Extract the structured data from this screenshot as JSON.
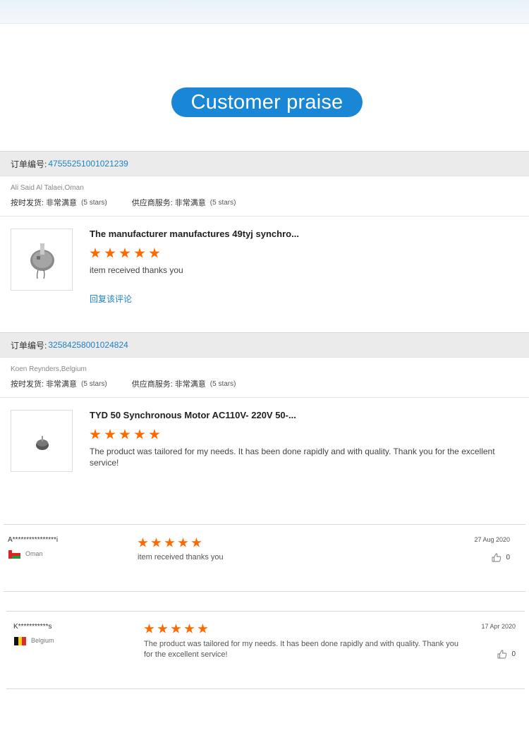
{
  "banner": {
    "title": "Customer praise"
  },
  "orders": [
    {
      "label": "订单编号:",
      "number": "47555251001021239",
      "buyer": "Ali Said Al Talaei,Oman",
      "delivery_label": "按时发货:",
      "delivery_value": "非常满意",
      "delivery_stars": "(5 stars)",
      "service_label": "供应商服务:",
      "service_value": "非常满意",
      "service_stars": "(5 stars)",
      "product_title": "The manufacturer manufactures 49tyj synchro...",
      "rating": 5,
      "comment": "item received thanks you",
      "reply_link": "回复该评论"
    },
    {
      "label": "订单编号:",
      "number": "32584258001024824",
      "buyer": "Koen Reynders,Belgium",
      "delivery_label": "按时发货:",
      "delivery_value": "非常满意",
      "delivery_stars": "(5 stars)",
      "service_label": "供应商服务:",
      "service_value": "非常满意",
      "service_stars": "(5 stars)",
      "product_title": "TYD 50 Synchronous Motor AC110V- 220V 50-...",
      "rating": 5,
      "comment": "The product was tailored for my needs. It has been done rapidly and with quality. Thank you for the excellent service!"
    }
  ],
  "reviews": [
    {
      "name": "A****************i",
      "country": "Oman",
      "rating": 5,
      "text": "item received thanks you",
      "date": "27 Aug 2020",
      "likes": "0"
    },
    {
      "name": "K***********s",
      "country": "Belgium",
      "rating": 5,
      "text": "The product was tailored for my needs. It has been done rapidly and with quality. Thank you for the excellent service!",
      "date": "17 Apr 2020",
      "likes": "0"
    }
  ],
  "colors": {
    "accent": "#1a86d6",
    "link": "#1f80c6",
    "star": "#ff6a00"
  }
}
